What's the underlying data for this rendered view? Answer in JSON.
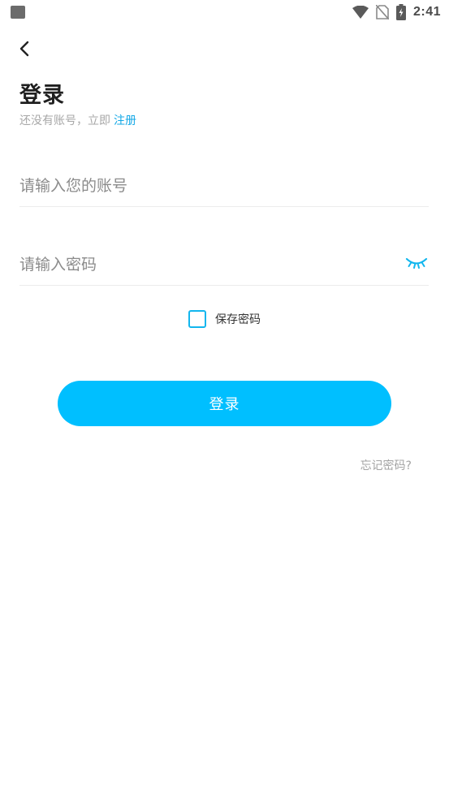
{
  "status_bar": {
    "time": "2:41",
    "icons": [
      "notification-square-icon",
      "wifi-icon",
      "no-sim-icon",
      "battery-charging-icon"
    ]
  },
  "header": {
    "back_icon": "chevron-left-icon",
    "title": "登录",
    "register_prompt": "还没有账号，立即",
    "register_link": "注册"
  },
  "form": {
    "account_placeholder": "请输入您的账号",
    "account_value": "",
    "password_placeholder": "请输入密码",
    "password_value": "",
    "password_toggle_icon": "eye-closed-icon",
    "remember_label": "保存密码",
    "remember_checked": false,
    "login_label": "登录",
    "forgot_label": "忘记密码?"
  },
  "colors": {
    "accent": "#00bfff",
    "link": "#14a8e6",
    "checkbox_border": "#12b6ee",
    "title": "#1f1f1f",
    "hint": "#a7a7a7"
  }
}
